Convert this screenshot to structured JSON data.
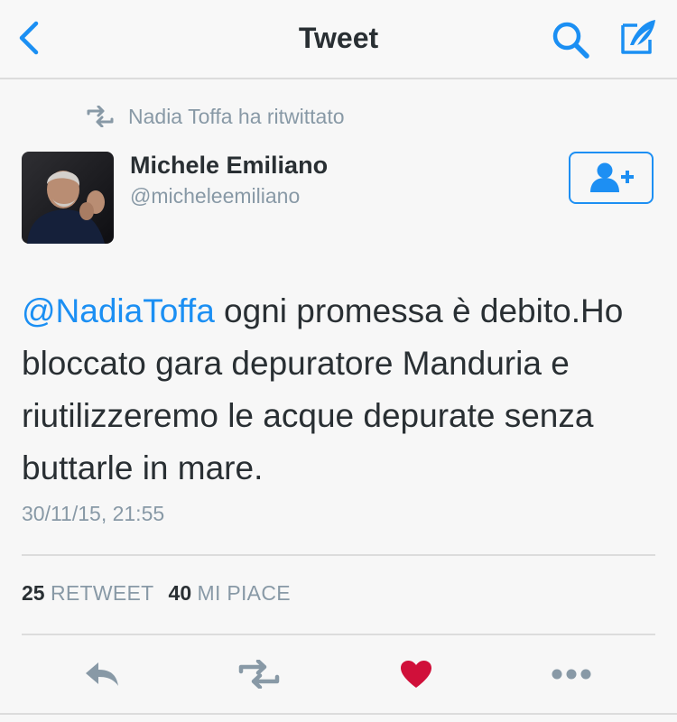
{
  "nav": {
    "title": "Tweet",
    "back_icon": "chevron-left-icon",
    "search_icon": "search-icon",
    "compose_icon": "compose-quill-icon",
    "accent_color": "#1b8ff3"
  },
  "retweet_context": {
    "icon": "retweet-icon",
    "label": "Nadia Toffa ha ritwittato"
  },
  "author": {
    "name": "Michele Emiliano",
    "handle": "@micheleemiliano",
    "follow_icon": "add-user-icon"
  },
  "tweet": {
    "mention": "@NadiaToffa",
    "body": " ogni promessa è debito.Ho bloccato gara depuratore Manduria e riutilizzeremo le acque depurate senza buttarle in mare.",
    "timestamp": "30/11/15, 21:55"
  },
  "stats": {
    "retweets_count": "25",
    "retweets_label": "RETWEET",
    "likes_count": "40",
    "likes_label": "MI PIACE"
  },
  "actions": {
    "reply_icon": "reply-icon",
    "retweet_icon": "retweet-icon",
    "like_icon": "heart-icon",
    "like_color": "#d0103a",
    "more_icon": "more-dots-icon"
  }
}
